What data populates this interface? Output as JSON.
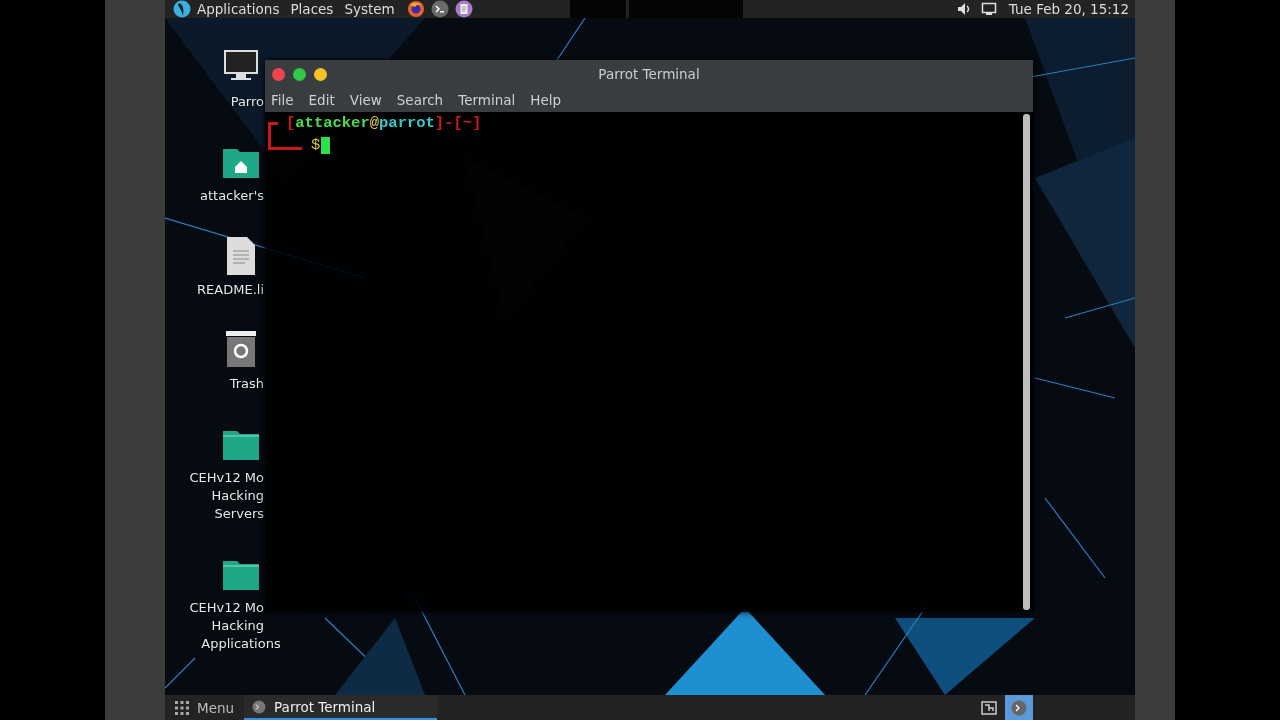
{
  "top_panel": {
    "menus": [
      "Applications",
      "Places",
      "System"
    ],
    "launchers": [
      {
        "kind": "browser"
      },
      {
        "kind": "terminal"
      },
      {
        "kind": "editor"
      }
    ],
    "clock": "Tue Feb 20, 15:12"
  },
  "desktop": {
    "icons": [
      {
        "kind": "computer",
        "lines": [
          {
            "text": "Parro",
            "clipped": true
          }
        ]
      },
      {
        "kind": "home",
        "lines": [
          {
            "text": "attacker's",
            "clipped": true
          }
        ]
      },
      {
        "kind": "document",
        "lines": [
          {
            "text": "README.li",
            "clipped": true
          }
        ]
      },
      {
        "kind": "trash",
        "lines": [
          {
            "text": "Trash",
            "clipped": true
          }
        ]
      },
      {
        "kind": "folder",
        "lines": [
          {
            "text": "CEHv12 Mo",
            "clipped": true
          },
          {
            "text": "Hacking",
            "clipped": true
          },
          {
            "text": "Servers",
            "clipped": true
          }
        ]
      },
      {
        "kind": "folder",
        "lines": [
          {
            "text": "CEHv12 Mo",
            "clipped": true
          },
          {
            "text": "Hacking",
            "clipped": true
          },
          {
            "text": "Applications",
            "clipped": false
          }
        ]
      }
    ]
  },
  "terminal": {
    "title": "Parrot Terminal",
    "menu": [
      "File",
      "Edit",
      "View",
      "Search",
      "Terminal",
      "Help"
    ],
    "prompt": [
      {
        "text": "[",
        "color": "#d01818"
      },
      {
        "text": "attacker",
        "color": "#4ed84e"
      },
      {
        "text": "@",
        "color": "#e0c040"
      },
      {
        "text": "parrot",
        "color": "#38c8c8"
      },
      {
        "text": "]-[",
        "color": "#d01818"
      },
      {
        "text": "~",
        "color": "#c82020"
      },
      {
        "text": "]",
        "color": "#d01818"
      }
    ],
    "symbol": "$"
  },
  "taskbar": {
    "menu": "Menu",
    "tasks": [
      {
        "title": "Parrot Terminal",
        "selected": true
      }
    ],
    "tray": [
      {
        "kind": "workspace",
        "selected": false
      },
      {
        "kind": "terminal",
        "selected": true
      }
    ]
  }
}
